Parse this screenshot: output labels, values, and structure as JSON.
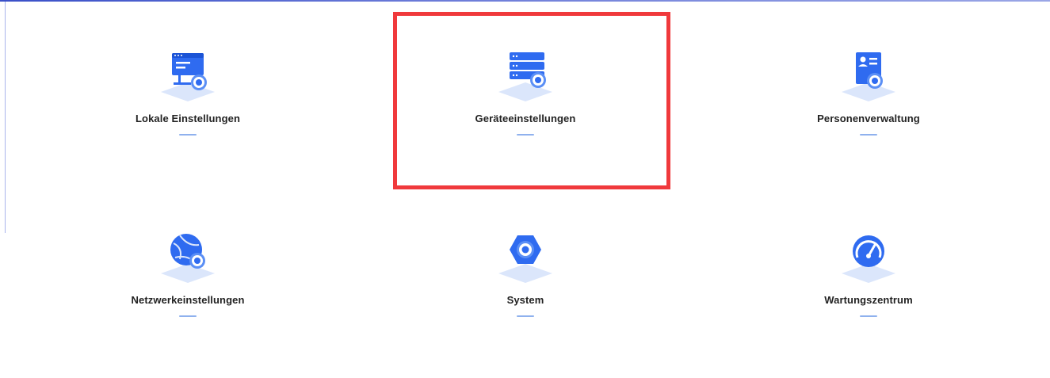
{
  "settings_menu": {
    "tiles": [
      {
        "label": "Lokale Einstellungen",
        "icon": "local-settings-icon"
      },
      {
        "label": "Geräteeinstellungen",
        "icon": "device-settings-icon"
      },
      {
        "label": "Personenverwaltung",
        "icon": "person-management-icon"
      },
      {
        "label": "Netzwerkeinstellungen",
        "icon": "network-settings-icon"
      },
      {
        "label": "System",
        "icon": "system-icon"
      },
      {
        "label": "Wartungszentrum",
        "icon": "maintenance-center-icon"
      }
    ],
    "highlighted_tile": "Geräteeinstellungen"
  },
  "colors": {
    "icon_primary": "#2f6bf0",
    "icon_light": "#dbe6fb",
    "highlight": "#f0393c",
    "label_text": "#222222",
    "underline": "#8fb1ee"
  }
}
